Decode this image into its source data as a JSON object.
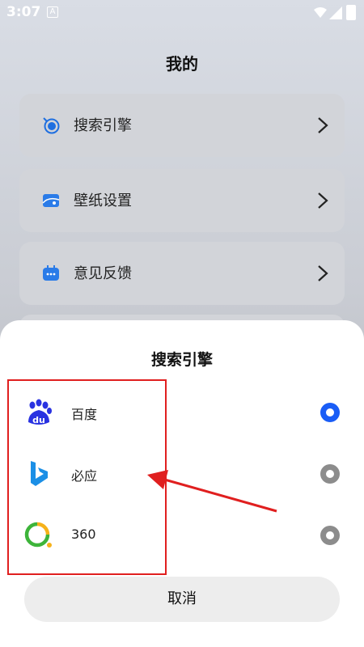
{
  "status_bar": {
    "time": "3:07",
    "notification_letter": "A",
    "icons": [
      "wifi-icon",
      "signal-icon",
      "battery-icon"
    ]
  },
  "page": {
    "title": "我的"
  },
  "menu": {
    "items": [
      {
        "label": "搜索引擎",
        "icon": "search-engine-icon"
      },
      {
        "label": "壁纸设置",
        "icon": "wallpaper-icon"
      },
      {
        "label": "意见反馈",
        "icon": "feedback-icon"
      }
    ]
  },
  "sheet": {
    "title": "搜索引擎",
    "options": [
      {
        "label": "百度",
        "logo": "baidu-logo",
        "selected": true
      },
      {
        "label": "必应",
        "logo": "bing-logo",
        "selected": false
      },
      {
        "label": "360",
        "logo": "360-logo",
        "selected": false
      }
    ],
    "cancel_label": "取消"
  },
  "colors": {
    "accent": "#1a5df6",
    "annotation": "#e01f1f",
    "radio_unselected": "#8c8c8c"
  }
}
